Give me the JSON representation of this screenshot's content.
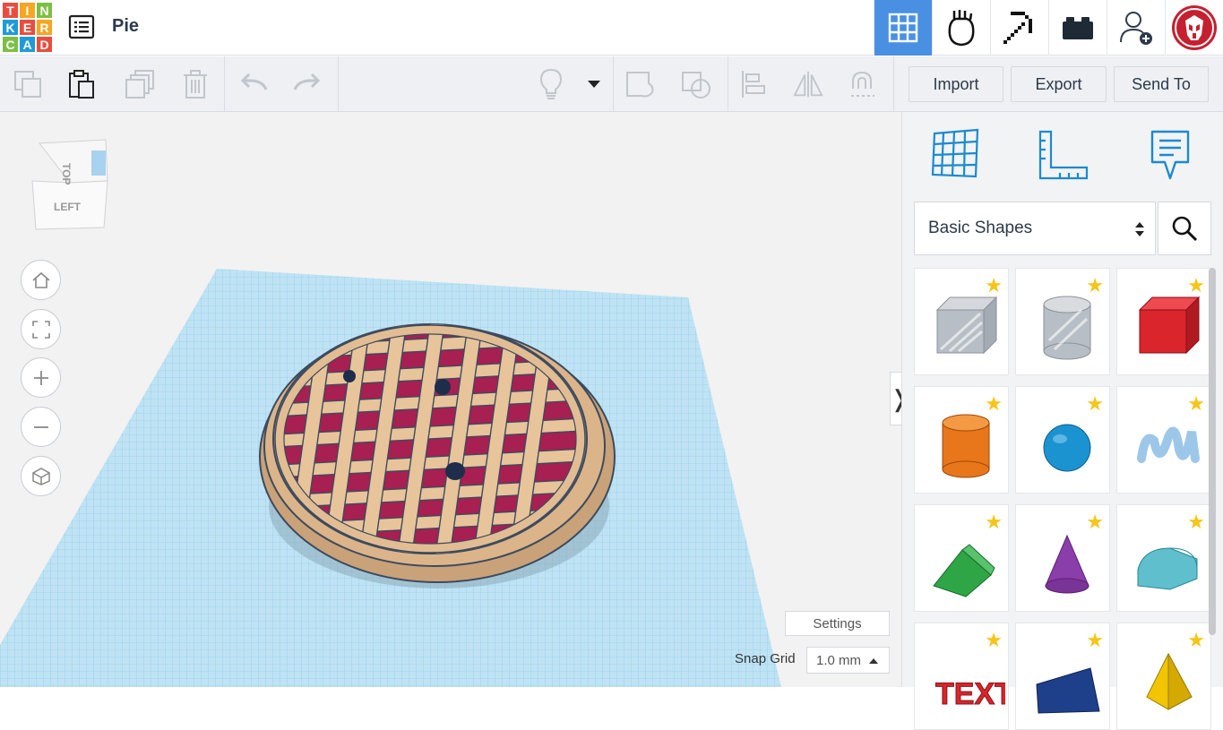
{
  "app": {
    "logo_letters": [
      "T",
      "I",
      "N",
      "K",
      "E",
      "R",
      "C",
      "A",
      "D"
    ],
    "logo_colors": [
      "#e94d3f",
      "#f5a623",
      "#7bc043",
      "#1e9bd7",
      "#e94d3f",
      "#f5a623",
      "#7bc043",
      "#1e9bd7",
      "#e94d3f"
    ],
    "document_title": "Pie"
  },
  "topbar": {
    "buttons": [
      {
        "name": "3d-design-view-icon",
        "active": true
      },
      {
        "name": "codeblocks-icon",
        "active": false
      },
      {
        "name": "minecraft-pickaxe-icon",
        "active": false
      },
      {
        "name": "lego-brick-icon",
        "active": false
      },
      {
        "name": "add-user-icon",
        "active": false
      },
      {
        "name": "user-avatar-icon",
        "active": false
      }
    ]
  },
  "toolbar": {
    "import_label": "Import",
    "export_label": "Export",
    "send_to_label": "Send To"
  },
  "viewcube": {
    "top_label": "TOP",
    "left_label": "LEFT"
  },
  "workplane": {
    "settings_label": "Settings",
    "snap_grid_label": "Snap Grid",
    "snap_grid_value": "1.0 mm"
  },
  "sidepanel": {
    "category": "Basic Shapes",
    "shapes": [
      {
        "name": "box-hole",
        "color": "#b8bec6"
      },
      {
        "name": "cylinder-hole",
        "color": "#b8bec6"
      },
      {
        "name": "box",
        "color": "#d9252b"
      },
      {
        "name": "cylinder",
        "color": "#e8761a"
      },
      {
        "name": "sphere",
        "color": "#1b93d1"
      },
      {
        "name": "scribble",
        "color": "#9cc7e8"
      },
      {
        "name": "roof",
        "color": "#2ea646"
      },
      {
        "name": "cone",
        "color": "#8a3eaa"
      },
      {
        "name": "round-roof",
        "color": "#5fbfcd"
      },
      {
        "name": "text",
        "color": "#d9252b"
      },
      {
        "name": "wedge",
        "color": "#1e3f8a"
      },
      {
        "name": "pyramid",
        "color": "#f2c500"
      }
    ]
  }
}
